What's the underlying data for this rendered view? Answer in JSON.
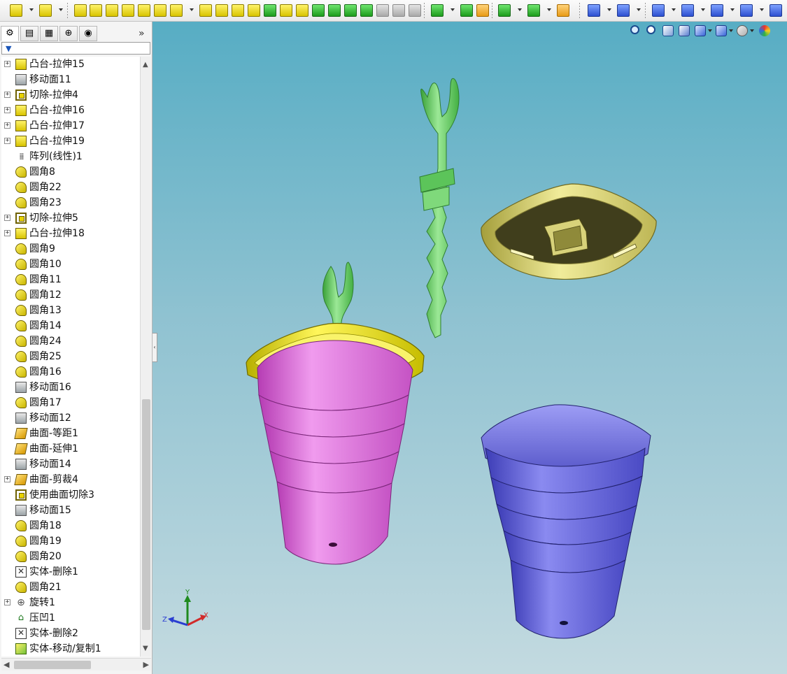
{
  "toolbar": {
    "icons": [
      "boss-extrude-icon",
      "revolved-boss-icon",
      "swept-boss-icon",
      "lofted-boss-icon",
      "boundary-boss-icon",
      "extruded-cut-icon",
      "revolved-cut-icon",
      "swept-cut-icon",
      "lofted-cut-icon",
      "boundary-cut-icon",
      "fillet-icon",
      "linear-pattern-icon",
      "rib-icon",
      "draft-icon",
      "shell-icon",
      "wrap-icon",
      "intersect-icon",
      "reference-geometry-icon",
      "curves-icon",
      "instant3d-icon",
      "sketch-icon",
      "smart-dimension-icon",
      "line-icon",
      "rectangle-icon",
      "slot-icon",
      "circle-icon",
      "arc-icon"
    ]
  },
  "left_panel": {
    "tabs": [
      {
        "name": "featuremanager-tab",
        "glyph": "⚙"
      },
      {
        "name": "propertymanager-tab",
        "glyph": "▤"
      },
      {
        "name": "configurationmanager-tab",
        "glyph": "▦"
      },
      {
        "name": "dimxpert-tab",
        "glyph": "⊕"
      },
      {
        "name": "display-manager-tab",
        "glyph": "◉"
      }
    ],
    "more_glyph": "»",
    "filter_glyph": "▼",
    "features": [
      {
        "label": "凸台-拉伸15",
        "icon": "boss",
        "expandable": true
      },
      {
        "label": "移动面11",
        "icon": "move",
        "expandable": false
      },
      {
        "label": "切除-拉伸4",
        "icon": "cut",
        "expandable": true
      },
      {
        "label": "凸台-拉伸16",
        "icon": "boss",
        "expandable": true
      },
      {
        "label": "凸台-拉伸17",
        "icon": "boss",
        "expandable": true
      },
      {
        "label": "凸台-拉伸19",
        "icon": "boss",
        "expandable": true
      },
      {
        "label": "阵列(线性)1",
        "icon": "pattern",
        "expandable": false
      },
      {
        "label": "圆角8",
        "icon": "fillet",
        "expandable": false
      },
      {
        "label": "圆角22",
        "icon": "fillet",
        "expandable": false
      },
      {
        "label": "圆角23",
        "icon": "fillet",
        "expandable": false
      },
      {
        "label": "切除-拉伸5",
        "icon": "cut",
        "expandable": true
      },
      {
        "label": "凸台-拉伸18",
        "icon": "boss",
        "expandable": true
      },
      {
        "label": "圆角9",
        "icon": "fillet",
        "expandable": false
      },
      {
        "label": "圆角10",
        "icon": "fillet",
        "expandable": false
      },
      {
        "label": "圆角11",
        "icon": "fillet",
        "expandable": false
      },
      {
        "label": "圆角12",
        "icon": "fillet",
        "expandable": false
      },
      {
        "label": "圆角13",
        "icon": "fillet",
        "expandable": false
      },
      {
        "label": "圆角14",
        "icon": "fillet",
        "expandable": false
      },
      {
        "label": "圆角24",
        "icon": "fillet",
        "expandable": false
      },
      {
        "label": "圆角25",
        "icon": "fillet",
        "expandable": false
      },
      {
        "label": "圆角16",
        "icon": "fillet",
        "expandable": false
      },
      {
        "label": "移动面16",
        "icon": "move",
        "expandable": false
      },
      {
        "label": "圆角17",
        "icon": "fillet",
        "expandable": false
      },
      {
        "label": "移动面12",
        "icon": "move",
        "expandable": false
      },
      {
        "label": "曲面-等距1",
        "icon": "surf",
        "expandable": false
      },
      {
        "label": "曲面-延伸1",
        "icon": "surf",
        "expandable": false
      },
      {
        "label": "移动面14",
        "icon": "move",
        "expandable": false
      },
      {
        "label": "曲面-剪裁4",
        "icon": "surf",
        "expandable": true
      },
      {
        "label": "使用曲面切除3",
        "icon": "cut",
        "expandable": false
      },
      {
        "label": "移动面15",
        "icon": "move",
        "expandable": false
      },
      {
        "label": "圆角18",
        "icon": "fillet",
        "expandable": false
      },
      {
        "label": "圆角19",
        "icon": "fillet",
        "expandable": false
      },
      {
        "label": "圆角20",
        "icon": "fillet",
        "expandable": false
      },
      {
        "label": "实体-删除1",
        "icon": "del",
        "expandable": false
      },
      {
        "label": "圆角21",
        "icon": "fillet",
        "expandable": false
      },
      {
        "label": "旋转1",
        "icon": "rev",
        "expandable": true
      },
      {
        "label": "压凹1",
        "icon": "dome",
        "expandable": false
      },
      {
        "label": "实体-删除2",
        "icon": "del",
        "expandable": false
      },
      {
        "label": "实体-移动/复制1",
        "icon": "copy",
        "expandable": false
      }
    ]
  },
  "viewport": {
    "heads_up_icons": [
      "zoom-to-fit-icon",
      "zoom-to-area-icon",
      "section-view-icon",
      "view-orientation-icon",
      "display-style-icon",
      "hide-show-items-icon",
      "edit-appearance-icon",
      "apply-scene-icon"
    ],
    "triad": {
      "x_label": "X",
      "y_label": "Y",
      "z_label": "Z"
    },
    "colors": {
      "pink_cup": "#e57be0",
      "blue_cup": "#6a6ad8",
      "yellow_lid": "#e3de2e",
      "green_stick": "#6fd06a",
      "olive_cap": "#c9c57a"
    }
  }
}
